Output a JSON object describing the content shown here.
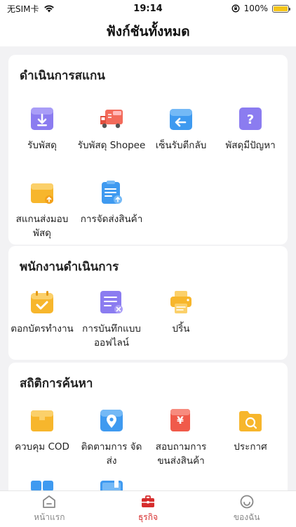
{
  "status_bar": {
    "carrier": "无SIM卡",
    "time": "19:14",
    "battery": "100%"
  },
  "header": {
    "title": "ฟังก์ชันทั้งหมด"
  },
  "sections": [
    {
      "title": "ดำเนินการสแกน",
      "items": [
        {
          "label": "รับพัสดุ",
          "icon": "receive-parcel-icon"
        },
        {
          "label": "รับพัสดุ Shopee",
          "icon": "shopee-truck-icon"
        },
        {
          "label": "เซ็นรับตีกลับ",
          "icon": "return-sign-icon"
        },
        {
          "label": "พัสดุมีปัญหา",
          "icon": "problem-parcel-icon"
        },
        {
          "label": "สแกนส่งมอบพัสดุ",
          "icon": "handover-scan-icon"
        },
        {
          "label": "การจัดส่งสินค้า",
          "icon": "delivery-clipboard-icon"
        }
      ]
    },
    {
      "title": "พนักงานดำเนินการ",
      "items": [
        {
          "label": "ตอกบัตรทำงาน",
          "icon": "clock-in-calendar-icon"
        },
        {
          "label": "การบันทึกแบบ ออฟไลน์",
          "icon": "offline-record-icon"
        },
        {
          "label": "ปริ้น",
          "icon": "printer-icon"
        }
      ]
    },
    {
      "title": "สถิติการค้นหา",
      "items": [
        {
          "label": "ควบคุม COD",
          "icon": "cod-box-icon"
        },
        {
          "label": "ติดตามการ จัดส่ง",
          "icon": "tracking-location-icon"
        },
        {
          "label": "สอบถามการ ขนส่งสินค้า",
          "icon": "yen-document-icon"
        },
        {
          "label": "ประกาศ",
          "icon": "announcement-folder-icon"
        }
      ]
    }
  ],
  "tabbar": {
    "items": [
      {
        "label": "หน้าแรก",
        "icon": "home-icon"
      },
      {
        "label": "ธุรกิจ",
        "icon": "briefcase-icon",
        "active": true
      },
      {
        "label": "ของฉัน",
        "icon": "smiley-icon"
      }
    ]
  },
  "colors": {
    "active_tab": "#d62d2d",
    "inactive_tab": "#888888"
  }
}
